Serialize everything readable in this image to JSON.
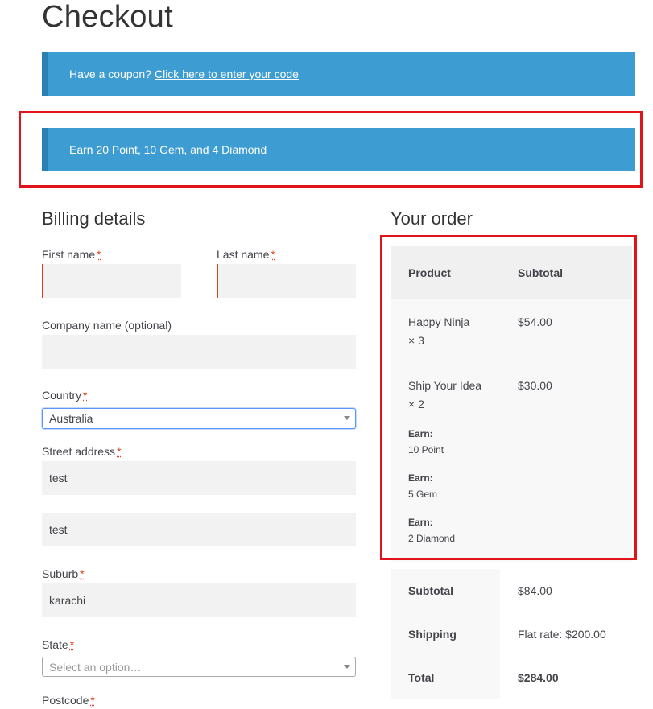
{
  "page": {
    "title": "Checkout"
  },
  "coupon_notice": {
    "text": "Have a coupon?",
    "link": "Click here to enter your code"
  },
  "earn_notice": {
    "text": "Earn 20 Point, 10 Gem, and 4 Diamond"
  },
  "billing": {
    "title": "Billing details",
    "required_mark": "*",
    "first_name": {
      "label": "First name",
      "value": ""
    },
    "last_name": {
      "label": "Last name",
      "value": ""
    },
    "company": {
      "label": "Company name (optional)",
      "value": ""
    },
    "country": {
      "label": "Country",
      "value": "Australia"
    },
    "street": {
      "label": "Street address",
      "line1": "test",
      "line2": "test"
    },
    "suburb": {
      "label": "Suburb",
      "value": "karachi"
    },
    "state": {
      "label": "State",
      "placeholder": "Select an option…"
    },
    "postcode": {
      "label": "Postcode"
    }
  },
  "order": {
    "title": "Your order",
    "headers": {
      "product": "Product",
      "subtotal": "Subtotal"
    },
    "items": [
      {
        "name": "Happy Ninja",
        "qty": "× 3",
        "price": "$54.00"
      },
      {
        "name": "Ship Your Idea",
        "qty": "× 2",
        "price": "$30.00",
        "earn": [
          {
            "label": "Earn:",
            "value": "10 Point"
          },
          {
            "label": "Earn:",
            "value": "5 Gem"
          },
          {
            "label": "Earn:",
            "value": "2 Diamond"
          }
        ]
      }
    ],
    "totals": {
      "subtotal": {
        "label": "Subtotal",
        "value": "$84.00"
      },
      "shipping": {
        "label": "Shipping",
        "value": "Flat rate: $200.00"
      },
      "total": {
        "label": "Total",
        "value": "$284.00"
      }
    }
  },
  "colors": {
    "notice": "#3d9cd2",
    "highlight": "#e0131a",
    "required": "#e2401c"
  }
}
